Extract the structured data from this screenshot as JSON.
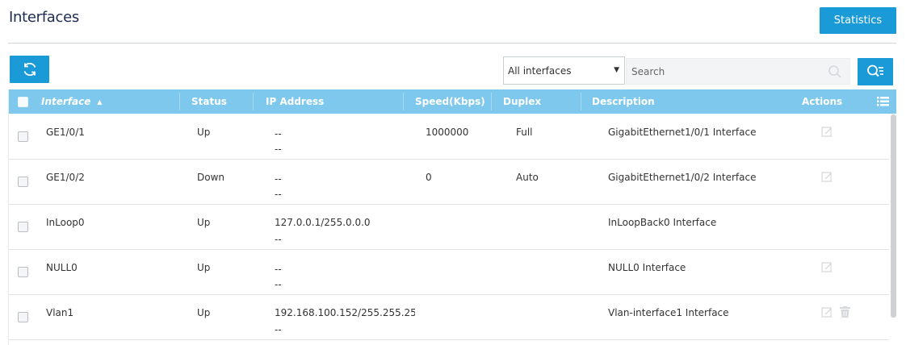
{
  "page": {
    "title": "Interfaces",
    "statistics_label": "Statistics"
  },
  "toolbar": {
    "filter_value": "All interfaces",
    "search_placeholder": "Search"
  },
  "table": {
    "columns": {
      "interface": "Interface",
      "status": "Status",
      "ip_address": "IP Address",
      "speed": "Speed(Kbps)",
      "duplex": "Duplex",
      "description": "Description",
      "actions": "Actions"
    },
    "rows": [
      {
        "interface": "GE1/0/1",
        "status": "Up",
        "ip": "--",
        "ip2": "--",
        "speed": "1000000",
        "duplex": "Full",
        "description": "GigabitEthernet1/0/1 Interface"
      },
      {
        "interface": "GE1/0/2",
        "status": "Down",
        "ip": "--",
        "ip2": "--",
        "speed": "0",
        "duplex": "Auto",
        "description": "GigabitEthernet1/0/2 Interface"
      },
      {
        "interface": "InLoop0",
        "status": "Up",
        "ip": "127.0.0.1/255.0.0.0",
        "ip2": "--",
        "speed": "",
        "duplex": "",
        "description": "InLoopBack0 Interface"
      },
      {
        "interface": "NULL0",
        "status": "Up",
        "ip": "--",
        "ip2": "--",
        "speed": "",
        "duplex": "",
        "description": "NULL0 Interface"
      },
      {
        "interface": "Vlan1",
        "status": "Up",
        "ip": "192.168.100.152/255.255.25!",
        "ip2": "--",
        "speed": "",
        "duplex": "",
        "description": "Vlan-interface1 Interface"
      }
    ]
  },
  "colors": {
    "accent": "#1a9ad6",
    "header_bg": "#7dc8ec"
  }
}
